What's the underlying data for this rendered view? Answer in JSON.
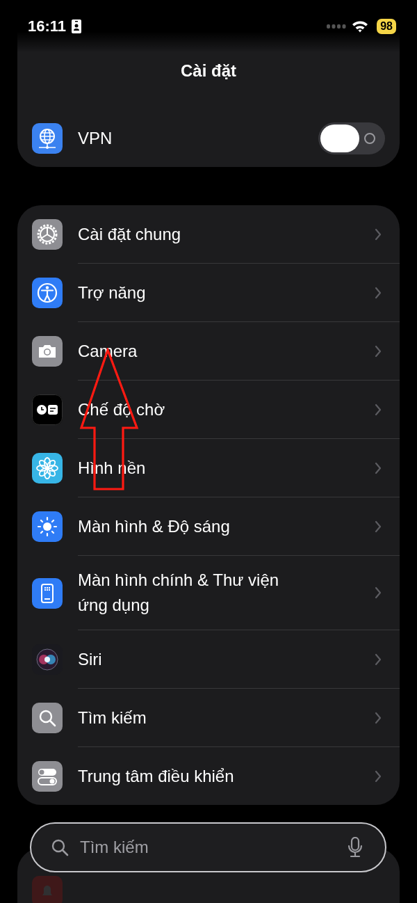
{
  "status_bar": {
    "time": "16:11",
    "battery": "98"
  },
  "navigation": {
    "title": "Cài đặt"
  },
  "groups": [
    {
      "rows": [
        {
          "kind": "toggle",
          "label": "VPN",
          "on": false
        }
      ]
    },
    {
      "rows": [
        {
          "kind": "link",
          "label": "Cài đặt chung"
        },
        {
          "kind": "link",
          "label": "Trợ năng"
        },
        {
          "kind": "link",
          "label": "Camera"
        },
        {
          "kind": "link",
          "label": "Chế độ chờ"
        },
        {
          "kind": "link",
          "label": "Hình nền"
        },
        {
          "kind": "link",
          "label": "Màn hình & Độ sáng"
        },
        {
          "kind": "link",
          "label": "Màn hình chính & Thư viện ứng dụng"
        },
        {
          "kind": "link",
          "label": "Siri"
        },
        {
          "kind": "link",
          "label": "Tìm kiếm"
        },
        {
          "kind": "link",
          "label": "Trung tâm điều khiển"
        }
      ]
    }
  ],
  "search": {
    "placeholder": "Tìm kiếm"
  }
}
